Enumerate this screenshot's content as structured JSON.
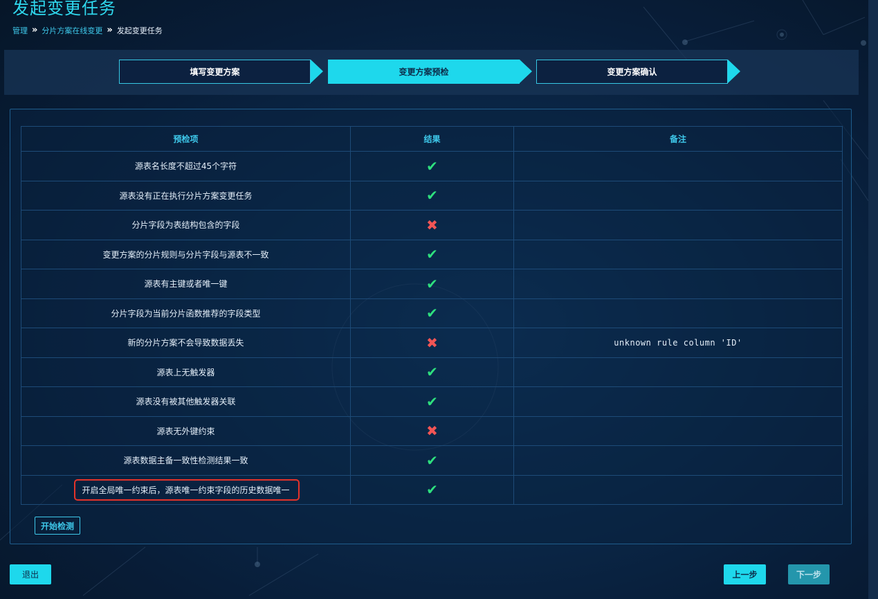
{
  "page": {
    "title": "发起变更任务"
  },
  "breadcrumb": {
    "items": [
      "管理",
      "分片方案在线变更",
      "发起变更任务"
    ],
    "separator": "»"
  },
  "steps": [
    {
      "label": "填写变更方案",
      "active": false
    },
    {
      "label": "变更方案预检",
      "active": true
    },
    {
      "label": "变更方案确认",
      "active": false
    }
  ],
  "table": {
    "headers": [
      "预检项",
      "结果",
      "备注"
    ],
    "rows": [
      {
        "item": "源表名长度不超过45个字符",
        "result": "pass",
        "note": ""
      },
      {
        "item": "源表没有正在执行分片方案变更任务",
        "result": "pass",
        "note": ""
      },
      {
        "item": "分片字段为表结构包含的字段",
        "result": "fail",
        "note": ""
      },
      {
        "item": "变更方案的分片规则与分片字段与源表不一致",
        "result": "pass",
        "note": ""
      },
      {
        "item": "源表有主键或者唯一键",
        "result": "pass",
        "note": ""
      },
      {
        "item": "分片字段为当前分片函数推荐的字段类型",
        "result": "pass",
        "note": ""
      },
      {
        "item": "新的分片方案不会导致数据丢失",
        "result": "fail",
        "note": "unknown rule column 'ID'"
      },
      {
        "item": "源表上无触发器",
        "result": "pass",
        "note": ""
      },
      {
        "item": "源表没有被其他触发器关联",
        "result": "pass",
        "note": ""
      },
      {
        "item": "源表无外键约束",
        "result": "fail",
        "note": ""
      },
      {
        "item": "源表数据主备一致性检测结果一致",
        "result": "pass",
        "note": ""
      },
      {
        "item": "开启全局唯一约束后，源表唯一约束字段的历史数据唯一",
        "result": "pass",
        "note": ""
      }
    ],
    "icons": {
      "pass": "check-icon",
      "fail": "cross-icon"
    },
    "highlighted_row": 11
  },
  "buttons": {
    "start": "开始检测",
    "exit": "退出",
    "prev": "上一步",
    "next": "下一步"
  },
  "colors": {
    "accent": "#1ed8ec",
    "pass": "#2ee07e",
    "fail": "#f25555",
    "highlight": "#e4332a",
    "background": "#0b2a4c"
  }
}
